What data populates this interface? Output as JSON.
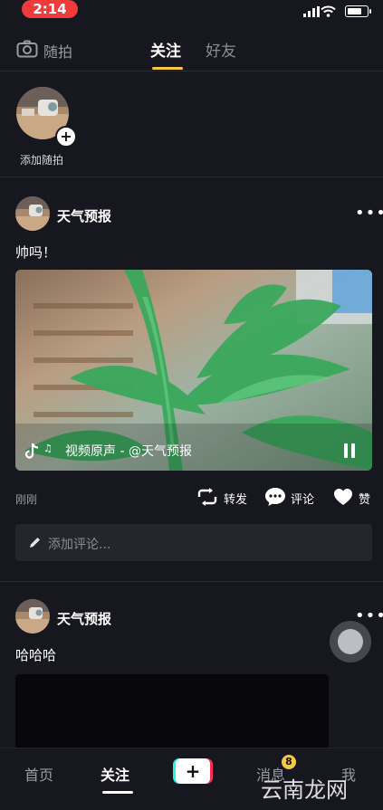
{
  "status_bar": {
    "time": "2:14",
    "battery_level": 0.8
  },
  "header": {
    "snap_label": "随拍",
    "tabs": [
      {
        "label": "关注",
        "active": true
      },
      {
        "label": "好友",
        "active": false
      }
    ]
  },
  "stories": {
    "add_label": "添加随拍",
    "plus": "+"
  },
  "posts": [
    {
      "username": "天气预报",
      "caption": "帅吗！",
      "audio": "视频原声 - @天气预报",
      "timestamp": "刚刚",
      "actions": {
        "repost": "转发",
        "comment": "评论",
        "like": "赞"
      },
      "comment_placeholder": "添加评论..."
    },
    {
      "username": "天气预报",
      "caption": "哈哈哈"
    }
  ],
  "bottom_nav": {
    "items": [
      {
        "label": "首页",
        "active": false
      },
      {
        "label": "关注",
        "active": true
      },
      {
        "label": "+",
        "active": false
      },
      {
        "label": "消息",
        "active": false,
        "badge": "8"
      },
      {
        "label": "我",
        "active": false
      }
    ]
  },
  "watermark": "云南龙网",
  "colors": {
    "background": "#17181f",
    "accent": "#f6c945",
    "time_pill": "#ef3b3b",
    "tiktok_cyan": "#25f4ee",
    "tiktok_red": "#fe2c55"
  }
}
